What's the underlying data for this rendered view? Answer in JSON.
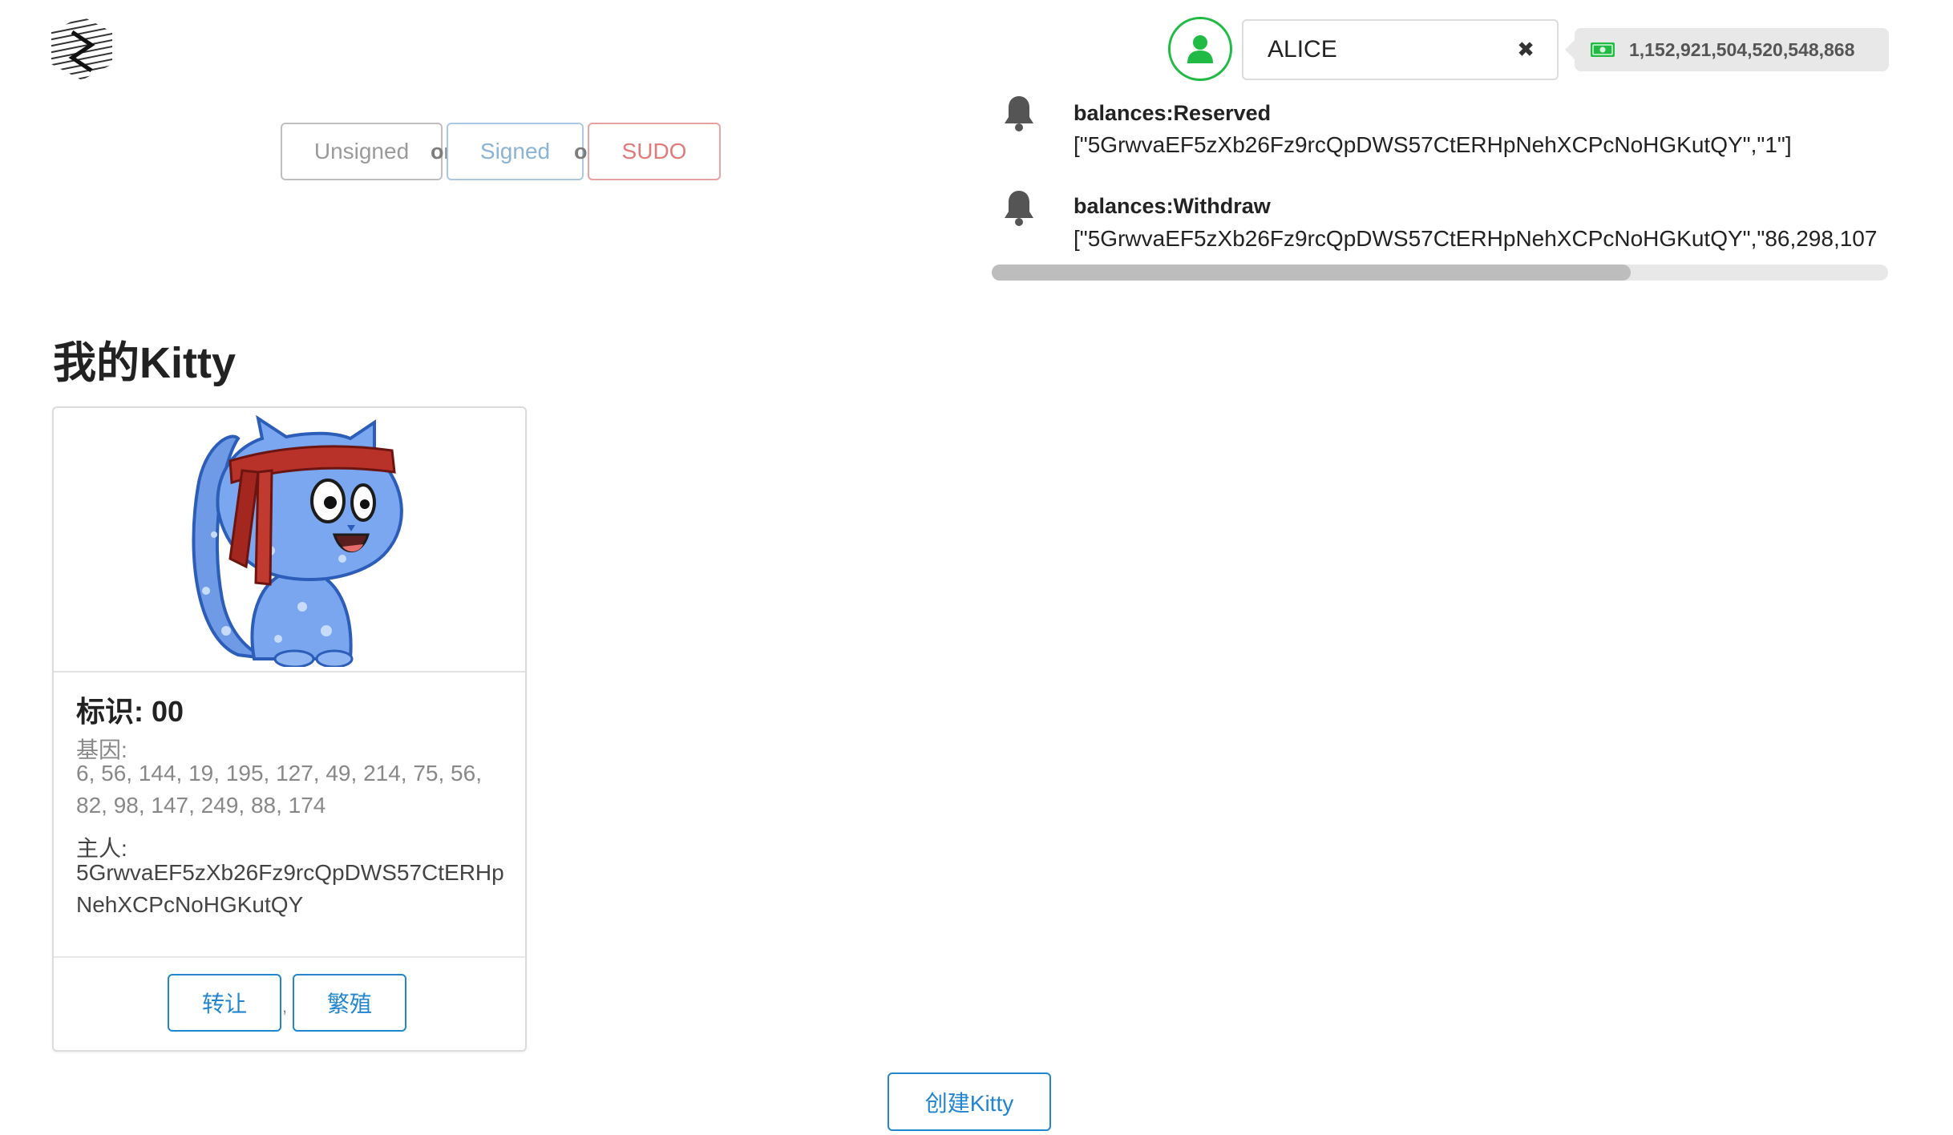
{
  "account": {
    "name": "ALICE",
    "clear_icon": "close-icon",
    "avatar_icon": "user-icon",
    "balance": "1,152,921,504,520,548,868",
    "balance_icon": "money-icon",
    "accent_color": "#21ba45"
  },
  "tx_buttons": {
    "unsigned": "Unsigned",
    "signed": "Signed",
    "sudo": "SUDO",
    "or": "or"
  },
  "events": [
    {
      "icon": "bell-icon",
      "title": "balances:Reserved",
      "data": "[\"5GrwvaEF5zXb26Fz9rcQpDWS57CtERHpNehXCPcNoHGKutQY\",\"1\"]"
    },
    {
      "icon": "bell-icon",
      "title": "balances:Withdraw",
      "data": "[\"5GrwvaEF5zXb26Fz9rcQpDWS57CtERHpNehXCPcNoHGKutQY\",\"86,298,107"
    }
  ],
  "section": {
    "title": "我的Kitty"
  },
  "kitty": {
    "id_label": "标识: 00",
    "dna_label": "基因:",
    "dna_value": "6, 56, 144, 19, 195, 127, 49, 214, 75, 56, 82, 98, 147, 249, 88, 174",
    "owner_label": "主人:",
    "owner_value": "5GrwvaEF5zXb26Fz9rcQpDWS57CtERHpNehXCPcNoHGKutQY",
    "transfer_label": "转让",
    "separator": ",",
    "breed_label": "繁殖"
  },
  "create_button": "创建Kitty",
  "colors": {
    "primary": "#2185d0",
    "signed": "#8ab3d6",
    "sudo": "#e37a7a"
  }
}
